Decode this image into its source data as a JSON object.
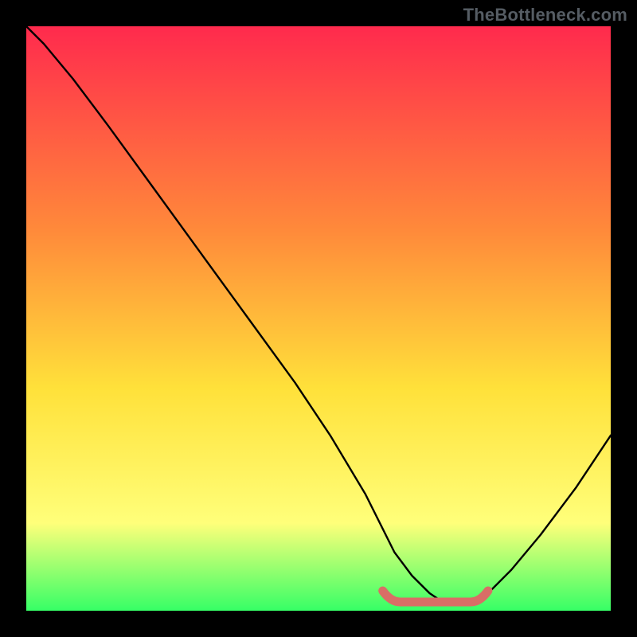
{
  "watermark": "TheBottleneck.com",
  "colors": {
    "gradient_top": "#ff2a4d",
    "gradient_mid1": "#ff8a3a",
    "gradient_mid2": "#ffe13a",
    "gradient_mid3": "#ffff7a",
    "gradient_bottom": "#36ff66",
    "curve": "#000000",
    "band": "#d96e66",
    "frame": "#000000"
  },
  "chart_data": {
    "type": "line",
    "title": "",
    "xlabel": "",
    "ylabel": "",
    "xlim": [
      0,
      100
    ],
    "ylim": [
      0,
      100
    ],
    "series": [
      {
        "name": "curve",
        "x": [
          0,
          3,
          8,
          14,
          22,
          30,
          38,
          46,
          52,
          58,
          61,
          63,
          66,
          69,
          72,
          74,
          76,
          79,
          83,
          88,
          94,
          100
        ],
        "y": [
          100,
          97,
          91,
          83,
          72,
          61,
          50,
          39,
          30,
          20,
          14,
          10,
          6,
          3,
          1,
          1,
          1,
          3,
          7,
          13,
          21,
          30
        ]
      }
    ],
    "highlight_band": {
      "x_start": 61,
      "x_end": 79,
      "y": 1.5
    }
  }
}
